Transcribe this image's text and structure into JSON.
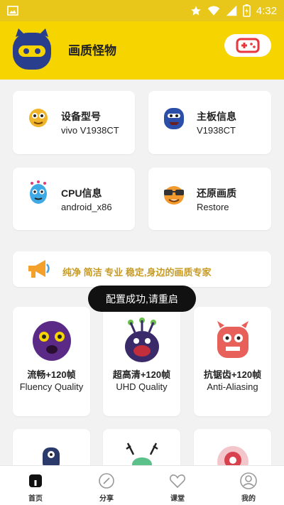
{
  "statusbar": {
    "time": "4:32",
    "icons": [
      "image-icon",
      "star-icon",
      "wifi-icon",
      "signal-icon",
      "battery-icon"
    ]
  },
  "header": {
    "title": "画质怪物",
    "game_button_icon": "gamepad-icon"
  },
  "info_cards": [
    {
      "title": "设备型号",
      "value": "vivo V1938CT",
      "icon": "mascot-yellow"
    },
    {
      "title": "主板信息",
      "value": "V1938CT",
      "icon": "mascot-blue"
    },
    {
      "title": "CPU信息",
      "value": "android_x86",
      "icon": "mascot-balloon"
    },
    {
      "title": "还原画质",
      "value": "Restore",
      "icon": "mascot-glasses"
    }
  ],
  "banner": {
    "text": "纯净 简洁 专业 稳定,身边的画质专家",
    "icon": "megaphone-icon"
  },
  "toast": {
    "text": "配置成功,请重启"
  },
  "mode_cards": [
    {
      "title": "流畅+120帧",
      "subtitle": "Fluency Quality"
    },
    {
      "title": "超高清+120帧",
      "subtitle": "UHD Quality"
    },
    {
      "title": "抗锯齿+120帧",
      "subtitle": "Anti-Aliasing"
    }
  ],
  "nav": {
    "home": "首页",
    "share": "分享",
    "class": "课堂",
    "mine": "我的"
  },
  "colors": {
    "accent": "#f5d400",
    "banner_text": "#c69a25",
    "game_button": "#e8373d"
  }
}
